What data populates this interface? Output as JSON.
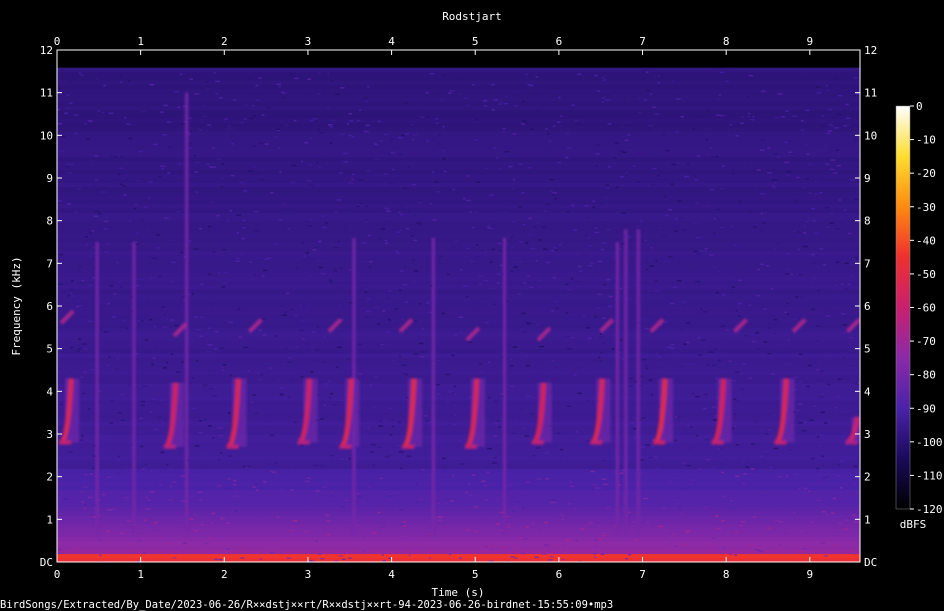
{
  "chart_data": {
    "type": "heatmap",
    "title": "Rodstjart",
    "xlabel": "Time (s)",
    "ylabel": "Frequency (kHz)",
    "colorbar_label": "dBFS",
    "xlim": [
      0,
      9.6
    ],
    "ylim": [
      0,
      12
    ],
    "x_ticks": [
      "0",
      "1",
      "2",
      "3",
      "4",
      "5",
      "6",
      "7",
      "8",
      "9"
    ],
    "y_ticks": [
      "DC",
      "1",
      "2",
      "3",
      "4",
      "5",
      "6",
      "7",
      "8",
      "9",
      "10",
      "11",
      "12"
    ],
    "colorbar_range": [
      -120,
      0
    ],
    "colorbar_ticks": [
      "0",
      "-10",
      "-20",
      "-30",
      "-40",
      "-50",
      "-60",
      "-70",
      "-80",
      "-90",
      "-100",
      "-110",
      "-120"
    ],
    "colormap": [
      "#000000",
      "#1a0a5a",
      "#4a22a8",
      "#8a2aa8",
      "#c8206e",
      "#ee3030",
      "#ff8a10",
      "#ffdd30",
      "#ffffff"
    ],
    "song_phrases": [
      {
        "t": 0.05,
        "f_low": 2.8,
        "f_high": 4.3,
        "db": -55
      },
      {
        "t": 1.3,
        "f_low": 2.7,
        "f_high": 4.2,
        "db": -58
      },
      {
        "t": 2.05,
        "f_low": 2.7,
        "f_high": 4.3,
        "db": -55
      },
      {
        "t": 2.9,
        "f_low": 2.8,
        "f_high": 4.3,
        "db": -58
      },
      {
        "t": 3.4,
        "f_low": 2.7,
        "f_high": 4.3,
        "db": -55
      },
      {
        "t": 4.15,
        "f_low": 2.7,
        "f_high": 4.3,
        "db": -52
      },
      {
        "t": 4.9,
        "f_low": 2.7,
        "f_high": 4.3,
        "db": -55
      },
      {
        "t": 5.7,
        "f_low": 2.8,
        "f_high": 4.2,
        "db": -56
      },
      {
        "t": 6.4,
        "f_low": 2.8,
        "f_high": 4.3,
        "db": -55
      },
      {
        "t": 7.15,
        "f_low": 2.8,
        "f_high": 4.3,
        "db": -52
      },
      {
        "t": 7.85,
        "f_low": 2.8,
        "f_high": 4.3,
        "db": -56
      },
      {
        "t": 8.6,
        "f_low": 2.8,
        "f_high": 4.3,
        "db": -55
      },
      {
        "t": 9.45,
        "f_low": 2.8,
        "f_high": 3.4,
        "db": -60
      }
    ],
    "upper_notes": [
      {
        "t": 0.05,
        "f": 5.8
      },
      {
        "t": 1.4,
        "f": 5.5
      },
      {
        "t": 2.3,
        "f": 5.6
      },
      {
        "t": 3.25,
        "f": 5.6
      },
      {
        "t": 4.1,
        "f": 5.6
      },
      {
        "t": 4.9,
        "f": 5.4
      },
      {
        "t": 5.75,
        "f": 5.4
      },
      {
        "t": 6.5,
        "f": 5.6
      },
      {
        "t": 7.1,
        "f": 5.6
      },
      {
        "t": 8.1,
        "f": 5.6
      },
      {
        "t": 8.8,
        "f": 5.6
      },
      {
        "t": 9.45,
        "f": 5.6
      }
    ],
    "vertical_clicks": [
      {
        "t": 0.48,
        "f_top": 7.5
      },
      {
        "t": 0.92,
        "f_top": 7.5
      },
      {
        "t": 1.55,
        "f_top": 11.0
      },
      {
        "t": 3.55,
        "f_top": 7.6
      },
      {
        "t": 4.5,
        "f_top": 7.6
      },
      {
        "t": 5.35,
        "f_top": 7.6
      },
      {
        "t": 6.7,
        "f_top": 7.5
      },
      {
        "t": 6.8,
        "f_top": 7.8
      },
      {
        "t": 6.95,
        "f_top": 7.8
      }
    ]
  },
  "footer": {
    "file_path": "BirdSongs/Extracted/By_Date/2023-06-26/R××dstj××rt/R××dstj××rt-94-2023-06-26-birdnet-15:55:09•mp3"
  }
}
